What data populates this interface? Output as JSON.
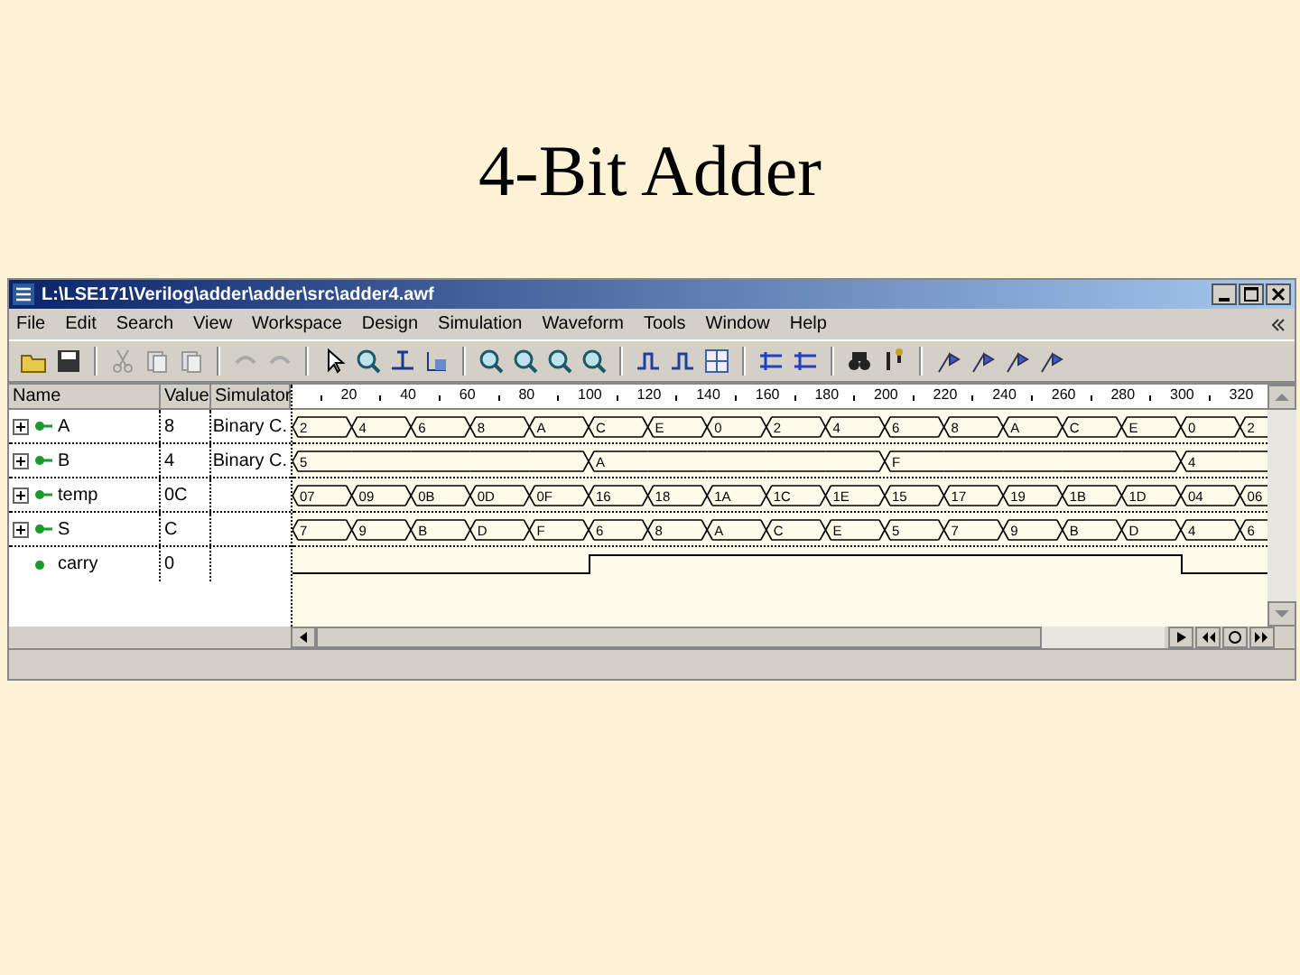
{
  "slide": {
    "title": "4-Bit Adder"
  },
  "window": {
    "title": "L:\\LSE171\\Verilog\\adder\\adder\\src\\adder4.awf"
  },
  "menu": [
    "File",
    "Edit",
    "Search",
    "View",
    "Workspace",
    "Design",
    "Simulation",
    "Waveform",
    "Tools",
    "Window",
    "Help"
  ],
  "columns": [
    "Name",
    "Value",
    "Simulator"
  ],
  "ruler": {
    "ticks": [
      "20",
      "40",
      "60",
      "80",
      "100",
      "120",
      "140",
      "160",
      "180",
      "200",
      "220",
      "240",
      "260",
      "280",
      "300",
      "320"
    ]
  },
  "signals": [
    {
      "name": "A",
      "kind": "bus",
      "expanded": false,
      "value": "8",
      "simulator": "Binary C.",
      "slots": [
        {
          "change": true,
          "value": "2"
        },
        {
          "change": true,
          "value": "4"
        },
        {
          "change": true,
          "value": "6"
        },
        {
          "change": true,
          "value": "8"
        },
        {
          "change": true,
          "value": "A"
        },
        {
          "change": true,
          "value": "C"
        },
        {
          "change": true,
          "value": "E"
        },
        {
          "change": true,
          "value": "0"
        },
        {
          "change": true,
          "value": "2"
        },
        {
          "change": true,
          "value": "4"
        },
        {
          "change": true,
          "value": "6"
        },
        {
          "change": true,
          "value": "8"
        },
        {
          "change": true,
          "value": "A"
        },
        {
          "change": true,
          "value": "C"
        },
        {
          "change": true,
          "value": "E"
        },
        {
          "change": true,
          "value": "0"
        },
        {
          "change": true,
          "value": "2"
        }
      ]
    },
    {
      "name": "B",
      "kind": "bus",
      "expanded": false,
      "value": "4",
      "simulator": "Binary C.",
      "slots": [
        {
          "change": true,
          "value": "5"
        },
        {
          "change": false
        },
        {
          "change": false
        },
        {
          "change": false
        },
        {
          "change": false
        },
        {
          "change": true,
          "value": "A"
        },
        {
          "change": false
        },
        {
          "change": false
        },
        {
          "change": false
        },
        {
          "change": false
        },
        {
          "change": true,
          "value": "F"
        },
        {
          "change": false
        },
        {
          "change": false
        },
        {
          "change": false
        },
        {
          "change": false
        },
        {
          "change": true,
          "value": "4"
        },
        {
          "change": false
        }
      ]
    },
    {
      "name": "temp",
      "kind": "bus",
      "expanded": false,
      "value": "0C",
      "slots": [
        {
          "change": true,
          "value": "07"
        },
        {
          "change": true,
          "value": "09"
        },
        {
          "change": true,
          "value": "0B"
        },
        {
          "change": true,
          "value": "0D"
        },
        {
          "change": true,
          "value": "0F"
        },
        {
          "change": true,
          "value": "16"
        },
        {
          "change": true,
          "value": "18"
        },
        {
          "change": true,
          "value": "1A"
        },
        {
          "change": true,
          "value": "1C"
        },
        {
          "change": true,
          "value": "1E"
        },
        {
          "change": true,
          "value": "15"
        },
        {
          "change": true,
          "value": "17"
        },
        {
          "change": true,
          "value": "19"
        },
        {
          "change": true,
          "value": "1B"
        },
        {
          "change": true,
          "value": "1D"
        },
        {
          "change": true,
          "value": "04"
        },
        {
          "change": true,
          "value": "06"
        }
      ]
    },
    {
      "name": "S",
      "kind": "bus",
      "expanded": false,
      "value": "C",
      "slots": [
        {
          "change": true,
          "value": "7"
        },
        {
          "change": true,
          "value": "9"
        },
        {
          "change": true,
          "value": "B"
        },
        {
          "change": true,
          "value": "D"
        },
        {
          "change": true,
          "value": "F"
        },
        {
          "change": true,
          "value": "6"
        },
        {
          "change": true,
          "value": "8"
        },
        {
          "change": true,
          "value": "A"
        },
        {
          "change": true,
          "value": "C"
        },
        {
          "change": true,
          "value": "E"
        },
        {
          "change": true,
          "value": "5"
        },
        {
          "change": true,
          "value": "7"
        },
        {
          "change": true,
          "value": "9"
        },
        {
          "change": true,
          "value": "B"
        },
        {
          "change": true,
          "value": "D"
        },
        {
          "change": true,
          "value": "4"
        },
        {
          "change": true,
          "value": "6"
        }
      ]
    },
    {
      "name": "carry",
      "kind": "bit",
      "value": "0",
      "trace": [
        false,
        false,
        false,
        false,
        false,
        true,
        true,
        true,
        true,
        true,
        true,
        true,
        true,
        true,
        true,
        false,
        false
      ]
    }
  ]
}
